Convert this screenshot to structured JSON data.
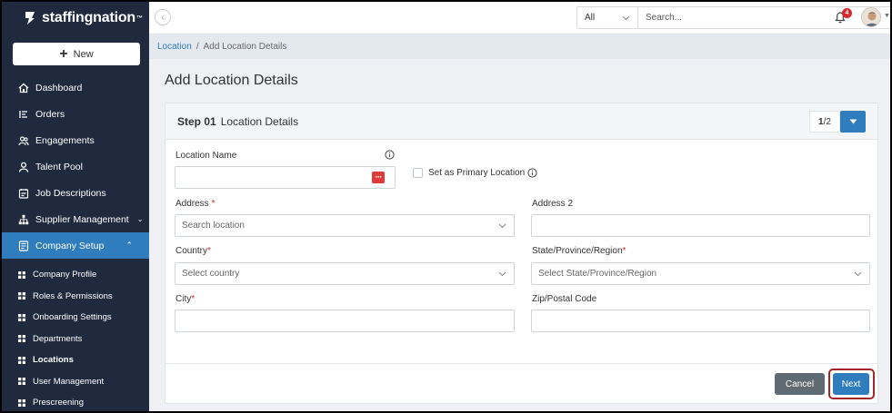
{
  "brand": {
    "name": "staffingnation",
    "tm": "™"
  },
  "sidebar": {
    "new_label": "New",
    "items": [
      {
        "label": "Dashboard",
        "icon": "home-icon"
      },
      {
        "label": "Orders",
        "icon": "list-icon"
      },
      {
        "label": "Engagements",
        "icon": "people-icon"
      },
      {
        "label": "Talent Pool",
        "icon": "person-icon"
      },
      {
        "label": "Job Descriptions",
        "icon": "calendar-icon"
      },
      {
        "label": "Supplier Management",
        "icon": "hierarchy-icon"
      },
      {
        "label": "Company Setup",
        "icon": "document-icon"
      }
    ],
    "subitems": [
      "Company Profile",
      "Roles & Permissions",
      "Onboarding Settings",
      "Departments",
      "Locations",
      "User Management",
      "Prescreening"
    ]
  },
  "topbar": {
    "scope": "All",
    "search_placeholder": "Search...",
    "notification_count": "4"
  },
  "breadcrumb": {
    "link": "Location",
    "separator": "/",
    "current": "Add Location Details"
  },
  "page": {
    "title": "Add Location Details",
    "step_num": "Step 01",
    "step_title": "Location Details",
    "pager_current": "1",
    "pager_total": "/2"
  },
  "form": {
    "location_name": "Location Name",
    "primary": "Set as Primary Location",
    "address": "Address",
    "address_placeholder": "Search location",
    "address2": "Address 2",
    "country": "Country",
    "country_placeholder": "Select country",
    "state": "State/Province/Region",
    "state_placeholder": "Select State/Province/Region",
    "city": "City",
    "zip": "Zip/Postal Code",
    "required_mark": "*"
  },
  "actions": {
    "cancel": "Cancel",
    "next": "Next"
  },
  "colors": {
    "sidebar": "#1f2a3f",
    "accent": "#2f7dbc",
    "required": "#d9262f"
  }
}
